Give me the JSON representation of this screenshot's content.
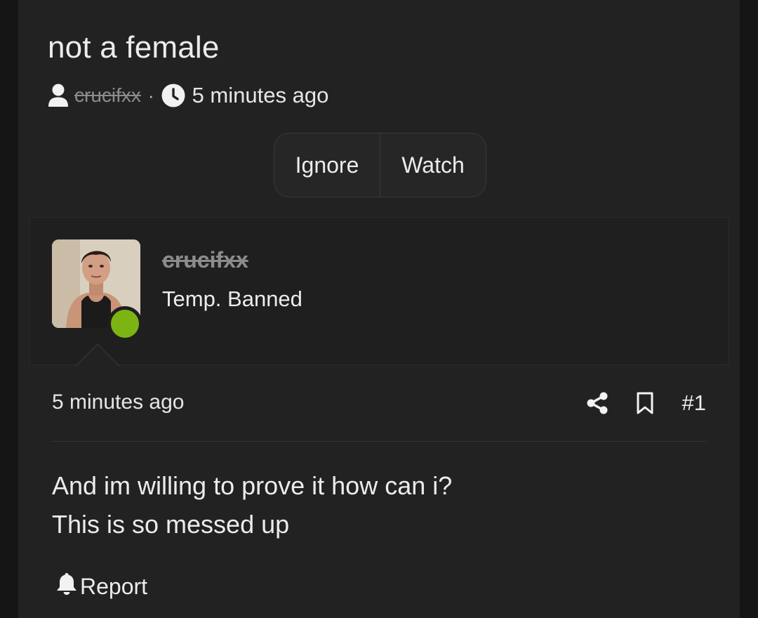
{
  "thread": {
    "title": "not a female",
    "author": "crucifxx",
    "separator": "·",
    "time": "5 minutes ago"
  },
  "actions": {
    "ignore_label": "Ignore",
    "watch_label": "Watch"
  },
  "post": {
    "username": "crucifxx",
    "user_title": "Temp. Banned",
    "online_status_color": "#7cb513",
    "date": "5 minutes ago",
    "number": "#1",
    "body_lines": [
      "And im willing to prove it how can i?",
      "This is so messed up"
    ],
    "report_label": "Report"
  },
  "icons": {
    "author": "user-icon",
    "time": "clock-icon",
    "share": "share-icon",
    "bookmark": "bookmark-icon",
    "report": "bell-icon"
  },
  "colors": {
    "background": "#151515",
    "card": "#222222",
    "text": "#ececec",
    "muted": "#8c8c8c"
  }
}
